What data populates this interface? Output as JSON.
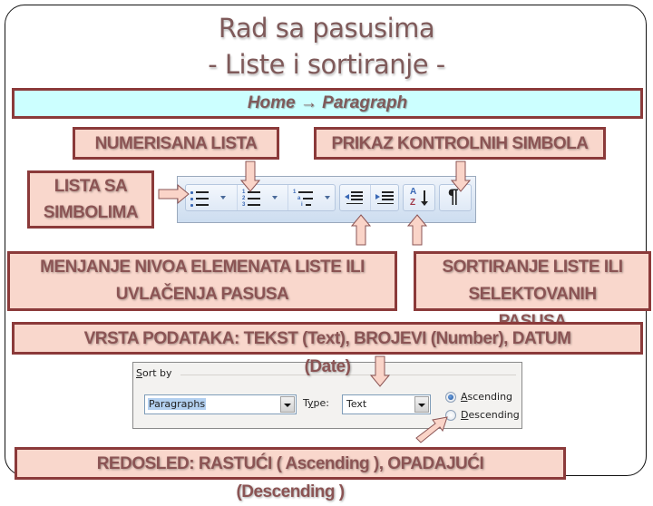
{
  "title": {
    "line1": "Rad sa pasusima",
    "line2": "- Liste i sortiranje -"
  },
  "nav_path": "Home → Paragraph",
  "callouts": {
    "numerisana": "NUMERISANA LISTA",
    "prikaz": "PRIKAZ KONTROLNIH SIMBOLA",
    "simbol_line1": "LISTA SA",
    "simbol_line2": "SIMBOLIMA",
    "menjanje_line1": "MENJANJE NIVOA ELEMENATA LISTE ILI",
    "menjanje_line2": "UVLAČENJA PASUSA",
    "sortiranje_line1": "SORTIRANJE LISTE ILI",
    "sortiranje_line2": "SELEKTOVANIH",
    "sortiranje_line3": "PASUSA",
    "vrsta_line1": "VRSTA PODATAKA: TEKST (Text), BROJEVI (Number), DATUM",
    "vrsta_line2": "(Date)",
    "redosled_line1": "REDOSLED: RASTUĆI ( Ascending ), OPADAJUĆI",
    "redosled_line2": "(Descending )"
  },
  "toolbar": {
    "buttons": [
      {
        "name": "bullets",
        "icon": "bullet-list-icon"
      },
      {
        "name": "numbering",
        "icon": "numbered-list-icon"
      },
      {
        "name": "multilevel",
        "icon": "multilevel-list-icon"
      },
      {
        "name": "decrease-indent",
        "icon": "decrease-indent-icon"
      },
      {
        "name": "increase-indent",
        "icon": "increase-indent-icon"
      },
      {
        "name": "sort",
        "icon": "sort-az-icon"
      },
      {
        "name": "show-hide",
        "icon": "pilcrow-icon"
      }
    ],
    "sort_letters": {
      "a": "A",
      "z": "Z"
    },
    "pilcrow": "¶"
  },
  "sort_dialog": {
    "sort_by_accel": "S",
    "sort_by_rest": "ort by",
    "sort_by_value": "Paragraphs",
    "type_pre": "T",
    "type_accel": "y",
    "type_rest": "pe:",
    "type_value": "Text",
    "ascending_accel": "A",
    "ascending_rest": "scending",
    "descending_accel": "D",
    "descending_rest": "escending",
    "selected_order": "Ascending"
  },
  "colors": {
    "callout_fill": "#f9d7cc",
    "callout_border": "#8b3a3a",
    "callout_text": "#8b5454",
    "nav_fill": "#ccffff",
    "arrow_fill": "#fad4c8"
  }
}
